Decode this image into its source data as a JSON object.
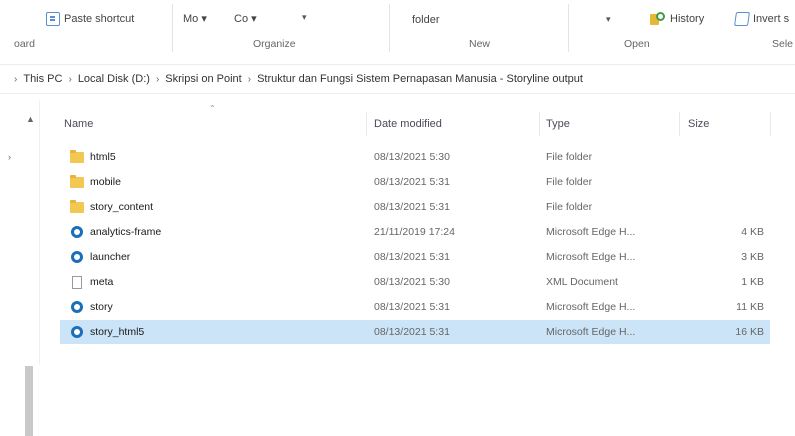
{
  "ribbon": {
    "paste_shortcut": "Paste shortcut",
    "move_to": "Mo ▾",
    "copy_to": "Co ▾",
    "new_item": "▾",
    "new_folder": "folder",
    "open_dropdown": "▾",
    "history": "History",
    "insert": "Invert s",
    "groups": {
      "clipboard": "oard",
      "organize": "Organize",
      "new": "New",
      "open": "Open",
      "select": "Sele"
    }
  },
  "breadcrumb": [
    "This PC",
    "Local Disk (D:)",
    "Skripsi on Point",
    "Struktur dan Fungsi Sistem Pernapasan Manusia - Storyline output"
  ],
  "columns": {
    "name": "Name",
    "date": "Date modified",
    "type": "Type",
    "size": "Size"
  },
  "files": [
    {
      "icon": "folder-icon",
      "name": "html5",
      "date": "08/13/2021 5:30",
      "type": "File folder",
      "size": ""
    },
    {
      "icon": "folder-icon",
      "name": "mobile",
      "date": "08/13/2021 5:31",
      "type": "File folder",
      "size": ""
    },
    {
      "icon": "folder-icon",
      "name": "story_content",
      "date": "08/13/2021 5:31",
      "type": "File folder",
      "size": ""
    },
    {
      "icon": "edge-icon",
      "name": "analytics-frame",
      "date": "21/11/2019 17:24",
      "type": "Microsoft Edge H...",
      "size": "4 KB"
    },
    {
      "icon": "edge-icon",
      "name": "launcher",
      "date": "08/13/2021 5:31",
      "type": "Microsoft Edge H...",
      "size": "3 KB"
    },
    {
      "icon": "xml-icon",
      "name": "meta",
      "date": "08/13/2021 5:30",
      "type": "XML Document",
      "size": "1 KB"
    },
    {
      "icon": "edge-icon",
      "name": "story",
      "date": "08/13/2021 5:31",
      "type": "Microsoft Edge H...",
      "size": "11 KB"
    },
    {
      "icon": "edge-icon",
      "name": "story_html5",
      "date": "08/13/2021 5:31",
      "type": "Microsoft Edge H...",
      "size": "16 KB",
      "selected": true
    }
  ],
  "colors": {
    "selection": "#cce4f7",
    "folder": "#f3c852",
    "edge": "#1b6fb8"
  }
}
